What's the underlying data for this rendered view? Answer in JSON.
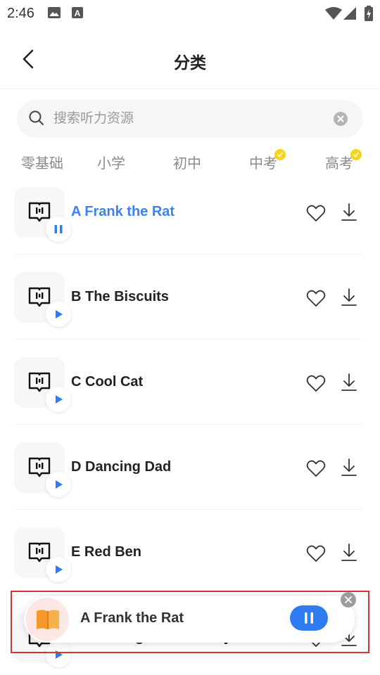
{
  "status_bar": {
    "time": "2:46",
    "icons": [
      "image-icon",
      "text-a-icon",
      "wifi-icon",
      "cellular-icon",
      "battery-charging-icon"
    ]
  },
  "header": {
    "title": "分类",
    "back_icon": "chevron-left-icon"
  },
  "search": {
    "placeholder": "搜索听力资源",
    "value": ""
  },
  "tabs": [
    {
      "label": "零基础",
      "badge": false
    },
    {
      "label": "小学",
      "badge": false
    },
    {
      "label": "初中",
      "badge": false
    },
    {
      "label": "中考",
      "badge": true
    },
    {
      "label": "高考",
      "badge": true
    }
  ],
  "list": {
    "items": [
      {
        "title": "A Frank the Rat",
        "state": "playing"
      },
      {
        "title": "B The Biscuits",
        "state": "paused"
      },
      {
        "title": "C Cool Cat",
        "state": "paused"
      },
      {
        "title": "D Dancing Dad",
        "state": "paused"
      },
      {
        "title": "E Red Ben",
        "state": "paused"
      },
      {
        "title": "F The Frog's Love Story",
        "state": "paused"
      }
    ]
  },
  "mini_player": {
    "title": "A Frank the Rat",
    "state": "playing"
  },
  "colors": {
    "accent": "#2f7cf0",
    "active_title": "#3b82f6",
    "badge": "#f5d51c",
    "highlight_border": "#d9322f"
  }
}
